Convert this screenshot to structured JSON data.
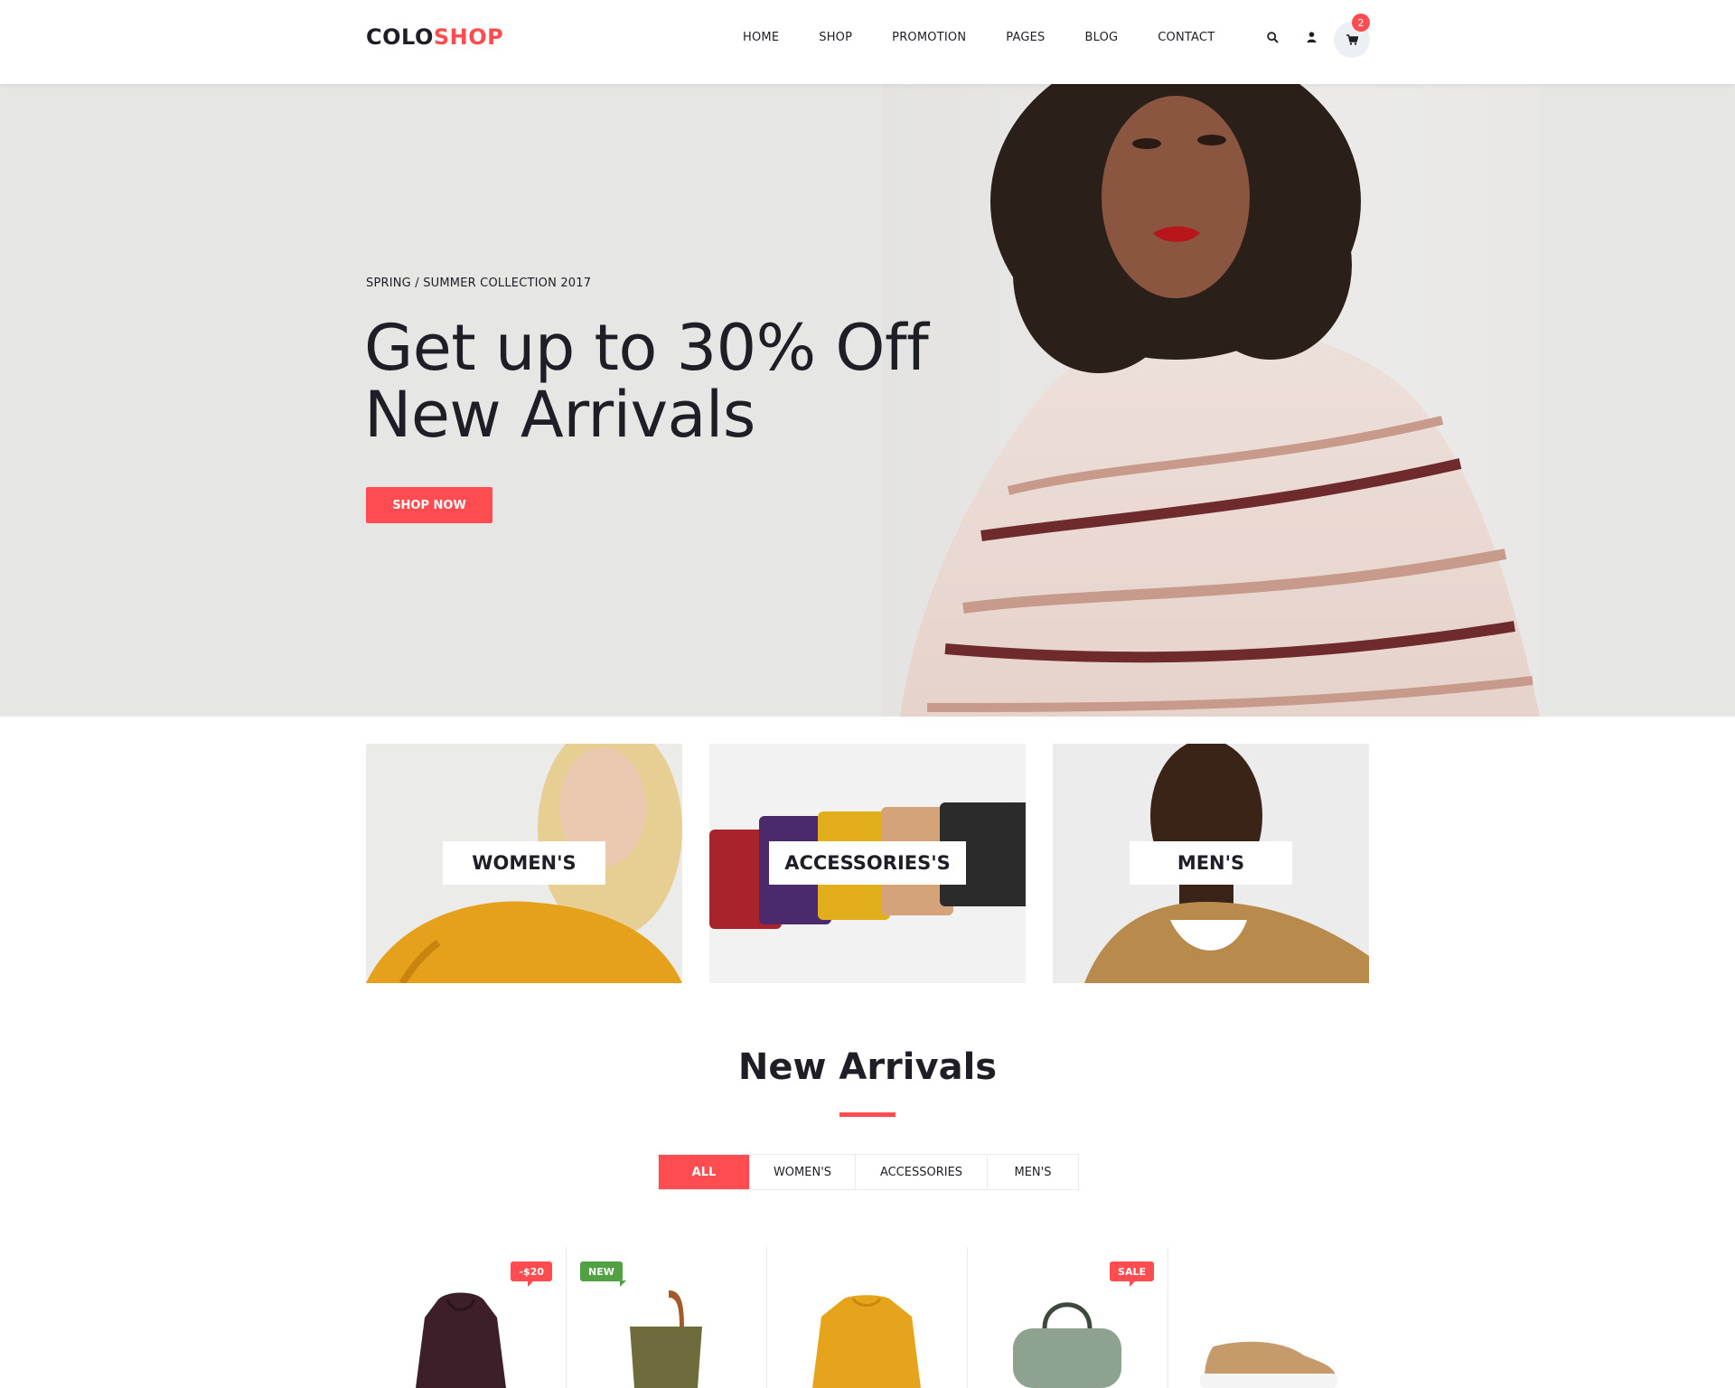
{
  "header": {
    "logo_part1": "COLO",
    "logo_part2": "SHOP",
    "nav": [
      "HOME",
      "SHOP",
      "PROMOTION",
      "PAGES",
      "BLOG",
      "CONTACT"
    ],
    "cart_count": "2",
    "icons": [
      "search-icon",
      "user-icon",
      "cart-icon"
    ]
  },
  "hero": {
    "subtitle": "SPRING / SUMMER COLLECTION 2017",
    "title_line1": "Get up to 30% Off",
    "title_line2": "New Arrivals",
    "button": "SHOP NOW"
  },
  "categories": [
    {
      "label": "WOMEN'S"
    },
    {
      "label": "ACCESSORIES'S"
    },
    {
      "label": "MEN'S"
    }
  ],
  "new_arrivals": {
    "title": "New Arrivals",
    "tabs": [
      "ALL",
      "WOMEN'S",
      "ACCESSORIES",
      "MEN'S"
    ],
    "active_tab": "ALL",
    "products": [
      {
        "badge": "-$20",
        "badge_color": "#fe4c50"
      },
      {
        "badge": "NEW",
        "badge_color": "#51a042"
      },
      {
        "badge": ""
      },
      {
        "badge": "SALE",
        "badge_color": "#fe4c50"
      },
      {
        "badge": ""
      }
    ]
  },
  "colors": {
    "accent": "#fe4c50",
    "new_badge": "#51a042",
    "text": "#1e1e27"
  }
}
